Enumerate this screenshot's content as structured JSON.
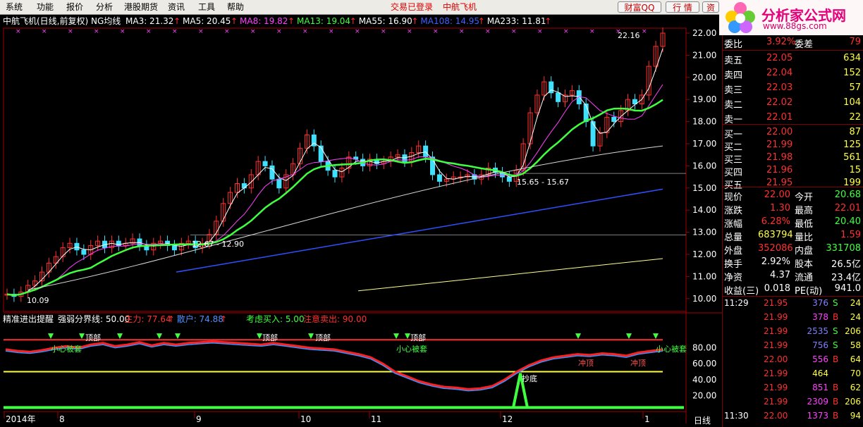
{
  "menu": {
    "items": [
      "系统",
      "功能",
      "报价",
      "分析",
      "港股期货",
      "资讯",
      "工具",
      "帮助"
    ],
    "center_left": "交易已登录",
    "center_right": "中航飞机",
    "buttons": [
      "财富QQ",
      "行 情",
      "资"
    ]
  },
  "logo": {
    "text": "分析家公式网",
    "url": "www.88gs.com"
  },
  "chart": {
    "stock_title": "中航飞机(日线,前复权) NG均线",
    "ma_labels": [
      {
        "text": "MA3: 21.32",
        "color": "#ffffff"
      },
      {
        "text": "MA5: 20.45",
        "color": "#ffffff"
      },
      {
        "text": "MA8: 19.82",
        "color": "#ff40ff"
      },
      {
        "text": "MA13: 19.04",
        "color": "#40ff40"
      },
      {
        "text": "MA55: 16.90",
        "color": "#ffffff"
      },
      {
        "text": "MA108: 14.95",
        "color": "#4060ff"
      },
      {
        "text": "MA233: 11.81",
        "color": "#ffffff"
      }
    ],
    "price_axis": [
      "22.00",
      "21.00",
      "20.00",
      "19.00",
      "18.00",
      "17.00",
      "16.00",
      "15.00",
      "14.00",
      "13.00",
      "12.00",
      "11.00",
      "10.00"
    ],
    "price_annotations": {
      "high": "22.16",
      "mid1": "15.65 - 15.67",
      "mid2": "12.67 - 12.90",
      "low": "10.09"
    },
    "indicator_title": "精准进出提醒",
    "indicator_labels": [
      {
        "text": "强弱分界线: 50.00",
        "color": "#ffffff"
      },
      {
        "text": "主力: 77.64",
        "color": "#ff3030"
      },
      {
        "text": "散户: 74.88",
        "color": "#5090ff"
      },
      {
        "text": "考虑买入: 5.00",
        "color": "#40ff40"
      },
      {
        "text": "注意卖出: 90.00",
        "color": "#ff3030"
      }
    ],
    "indicator_axis": [
      "80.00",
      "60.00",
      "40.00",
      "20.00"
    ],
    "signals": {
      "buy": "小心被套",
      "top": "顶部",
      "rush": "冲顶",
      "bottom": "抄底"
    },
    "date_axis": [
      "2014年",
      "8",
      "9",
      "10",
      "11",
      "12",
      "1"
    ],
    "period_label": "日线"
  },
  "quote": {
    "ratio": {
      "label": "委比",
      "value": "3.92%",
      "label2": "委差",
      "value2": "79"
    },
    "asks": [
      {
        "label": "卖五",
        "price": "22.05",
        "vol": "634"
      },
      {
        "label": "卖四",
        "price": "22.04",
        "vol": "152"
      },
      {
        "label": "卖三",
        "price": "22.03",
        "vol": "57"
      },
      {
        "label": "卖二",
        "price": "22.02",
        "vol": "104"
      },
      {
        "label": "卖一",
        "price": "22.01",
        "vol": "22"
      }
    ],
    "bids": [
      {
        "label": "买一",
        "price": "22.00",
        "vol": "87"
      },
      {
        "label": "买二",
        "price": "21.99",
        "vol": "125"
      },
      {
        "label": "买三",
        "price": "21.98",
        "vol": "561"
      },
      {
        "label": "买四",
        "price": "21.96",
        "vol": "15"
      },
      {
        "label": "买五",
        "price": "21.95",
        "vol": "199"
      }
    ],
    "stats": [
      {
        "l1": "现价",
        "v1": "22.00",
        "c1": "#ff3030",
        "l2": "今开",
        "v2": "20.68",
        "c2": "#40ff40"
      },
      {
        "l1": "涨跌",
        "v1": "1.30",
        "c1": "#ff3030",
        "l2": "最高",
        "v2": "22.01",
        "c2": "#ff3030"
      },
      {
        "l1": "涨幅",
        "v1": "6.28%",
        "c1": "#ff3030",
        "l2": "最低",
        "v2": "20.40",
        "c2": "#40ff40"
      },
      {
        "l1": "总量",
        "v1": "683794",
        "c1": "#ffff40",
        "l2": "量比",
        "v2": "1.59",
        "c2": "#ff3030"
      },
      {
        "l1": "外盘",
        "v1": "352086",
        "c1": "#ff3030",
        "l2": "内盘",
        "v2": "331708",
        "c2": "#40ff40"
      },
      {
        "l1": "换手",
        "v1": "2.92%",
        "c1": "#ffffff",
        "l2": "股本",
        "v2": "26.5亿",
        "c2": "#ffffff"
      },
      {
        "l1": "净资",
        "v1": "4.37",
        "c1": "#ffffff",
        "l2": "流通",
        "v2": "23.4亿",
        "c2": "#ffffff"
      },
      {
        "l1": "收益(三)",
        "v1": "0.018",
        "c1": "#ffffff",
        "l2": "PE(动)",
        "v2": "941.0",
        "c2": "#ffffff"
      }
    ],
    "ticks": [
      {
        "time": "11:29",
        "price": "21.95",
        "vol": "376",
        "side": "S",
        "n": "24"
      },
      {
        "time": "",
        "price": "21.99",
        "vol": "378",
        "side": "B",
        "n": "24"
      },
      {
        "time": "",
        "price": "21.99",
        "vol": "2535",
        "side": "S",
        "n": "206"
      },
      {
        "time": "",
        "price": "21.99",
        "vol": "756",
        "side": "S",
        "n": "58"
      },
      {
        "time": "",
        "price": "22.00",
        "vol": "556",
        "side": "B",
        "n": "64"
      },
      {
        "time": "",
        "price": "21.99",
        "vol": "464",
        "side": "",
        "n": "70"
      },
      {
        "time": "",
        "price": "21.99",
        "vol": "851",
        "side": "B",
        "n": "62"
      },
      {
        "time": "",
        "price": "21.99",
        "vol": "2309",
        "side": "B",
        "n": "206"
      },
      {
        "time": "11:30",
        "price": "22.00",
        "vol": "1373",
        "side": "B",
        "n": "94"
      }
    ]
  }
}
